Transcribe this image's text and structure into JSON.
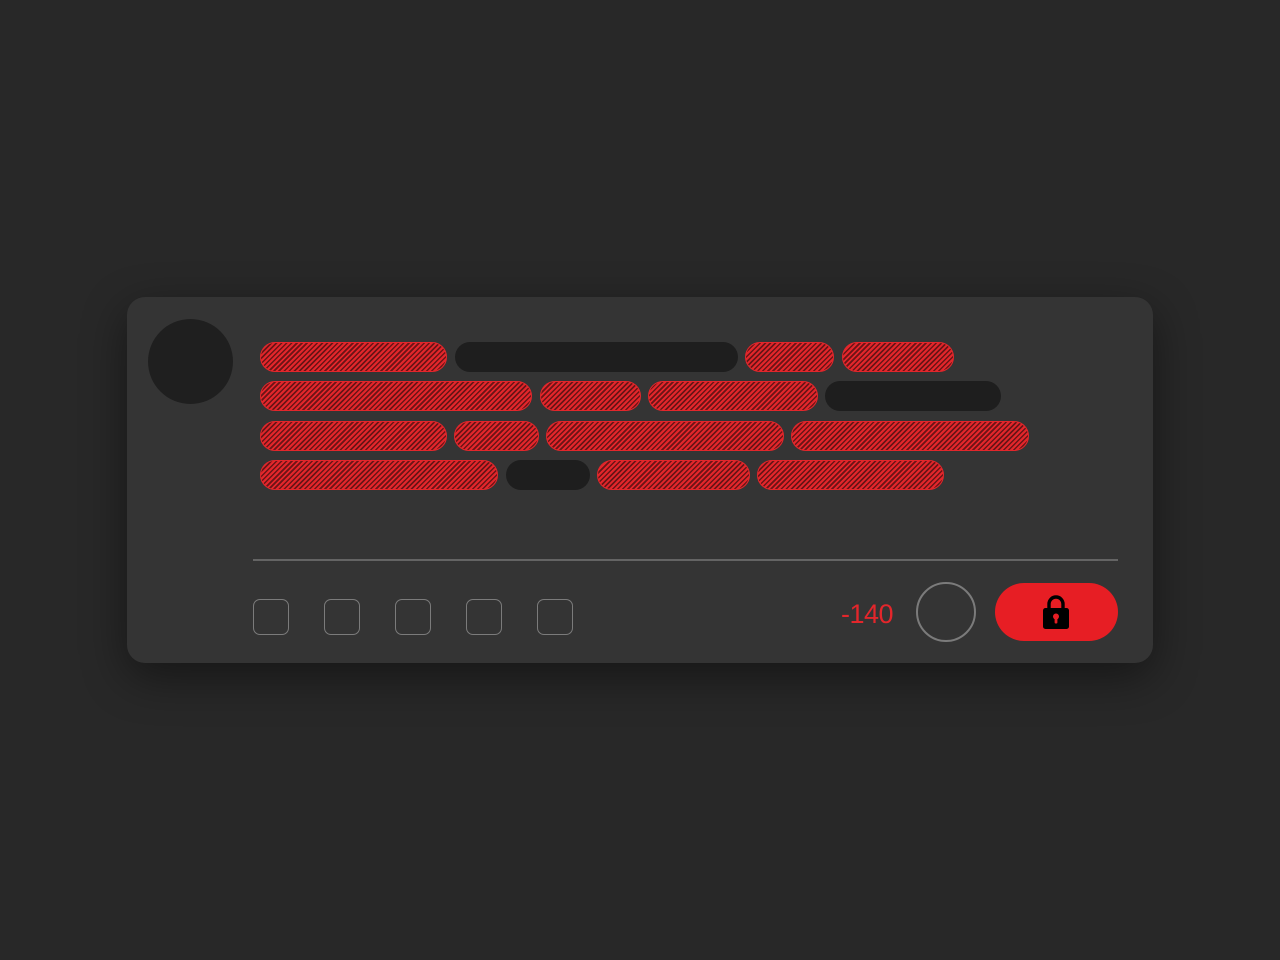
{
  "composer": {
    "character_counter": "-140",
    "submit_button_icon": "lock-icon",
    "accent_color": "#e3262b",
    "text_tokens": [
      [
        {
          "flagged": true
        },
        {
          "flagged": false
        },
        {
          "flagged": true
        },
        {
          "flagged": true
        }
      ],
      [
        {
          "flagged": true
        },
        {
          "flagged": true
        },
        {
          "flagged": true
        },
        {
          "flagged": false
        }
      ],
      [
        {
          "flagged": true
        },
        {
          "flagged": true
        },
        {
          "flagged": true
        },
        {
          "flagged": true
        }
      ],
      [
        {
          "flagged": true
        },
        {
          "flagged": false
        },
        {
          "flagged": true
        },
        {
          "flagged": true
        }
      ]
    ],
    "toolbar_icons": [
      "toolbar-icon-1",
      "toolbar-icon-2",
      "toolbar-icon-3",
      "toolbar-icon-4",
      "toolbar-icon-5"
    ]
  }
}
